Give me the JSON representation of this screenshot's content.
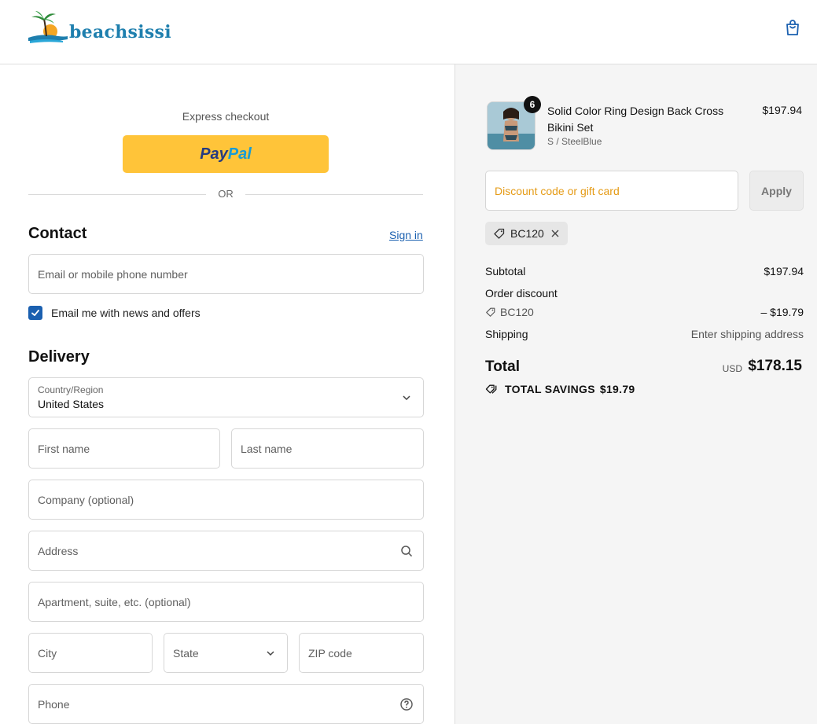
{
  "header": {
    "brand": "beachsissi"
  },
  "express": {
    "label": "Express checkout",
    "paypal_part1": "Pay",
    "paypal_part2": "Pal",
    "or_text": "OR"
  },
  "contact": {
    "title": "Contact",
    "sign_in": "Sign in",
    "email_placeholder": "Email or mobile phone number",
    "news_label": "Email me with news and offers",
    "news_checked": true
  },
  "delivery": {
    "title": "Delivery",
    "country_label": "Country/Region",
    "country_value": "United States",
    "first_name": "First name",
    "last_name": "Last name",
    "company": "Company (optional)",
    "address": "Address",
    "apartment": "Apartment, suite, etc. (optional)",
    "city": "City",
    "state": "State",
    "zip": "ZIP code",
    "phone": "Phone"
  },
  "order": {
    "product_name": "Solid Color Ring Design Back Cross Bikini Set",
    "product_variant": "S / SteelBlue",
    "product_price": "$197.94",
    "quantity": "6",
    "discount_placeholder": "Discount code or gift card",
    "apply_label": "Apply",
    "applied_code": "BC120",
    "subtotal_label": "Subtotal",
    "subtotal_value": "$197.94",
    "order_discount_label": "Order discount",
    "discount_code": "BC120",
    "discount_value": "– $19.79",
    "shipping_label": "Shipping",
    "shipping_value": "Enter shipping address",
    "total_label": "Total",
    "currency": "USD",
    "total_value": "$178.15",
    "savings_label": "TOTAL SAVINGS",
    "savings_value": "$19.79"
  },
  "colors": {
    "accent": "#1b60b0",
    "paypal": "#ffc439",
    "discount_placeholder": "#e59b16",
    "brand": "#1e7fae"
  }
}
